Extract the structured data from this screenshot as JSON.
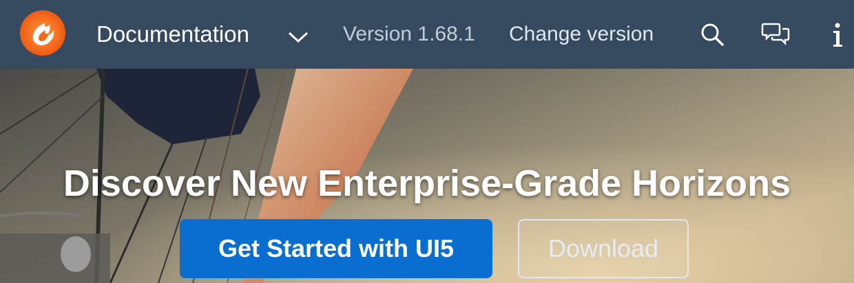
{
  "header": {
    "logo_icon": "openui5-flame-logo",
    "title": "Documentation",
    "version_label": "Version 1.68.1",
    "change_version_label": "Change version",
    "icons": [
      "search-icon",
      "feedback-icon",
      "info-icon"
    ]
  },
  "hero": {
    "headline": "Discover New Enterprise-Grade Horizons",
    "primary_button": "Get Started with UI5",
    "secondary_button": "Download"
  },
  "colors": {
    "header_bg": "#354a5f",
    "primary_button": "#0a6ed1",
    "logo_orange": "#f26b1d"
  }
}
